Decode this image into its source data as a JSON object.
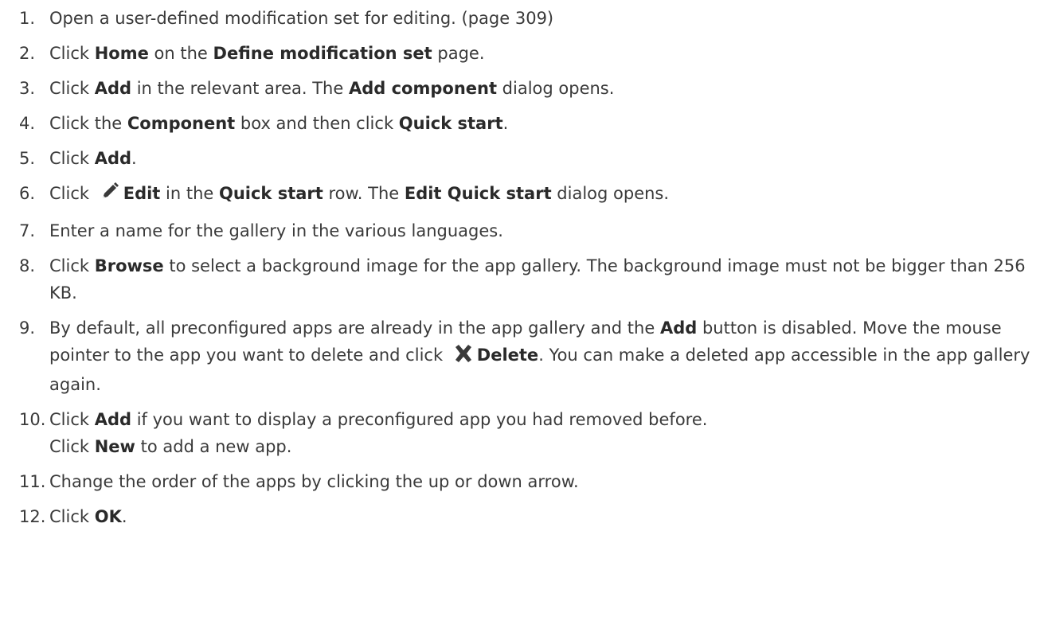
{
  "steps": [
    {
      "num": "1.",
      "parts": [
        {
          "t": "Open a user-defined modification set for editing. (page 309)"
        }
      ]
    },
    {
      "num": "2.",
      "parts": [
        {
          "t": "Click "
        },
        {
          "b": "Home"
        },
        {
          "t": " on the "
        },
        {
          "b": "Define modification set"
        },
        {
          "t": " page."
        }
      ]
    },
    {
      "num": "3.",
      "parts": [
        {
          "t": "Click "
        },
        {
          "b": "Add"
        },
        {
          "t": " in the relevant area. The "
        },
        {
          "b": "Add component"
        },
        {
          "t": " dialog opens."
        }
      ]
    },
    {
      "num": "4.",
      "parts": [
        {
          "t": "Click the "
        },
        {
          "b": "Component"
        },
        {
          "t": " box and then click "
        },
        {
          "b": "Quick start"
        },
        {
          "t": "."
        }
      ]
    },
    {
      "num": "5.",
      "parts": [
        {
          "t": "Click "
        },
        {
          "b": "Add"
        },
        {
          "t": "."
        }
      ]
    },
    {
      "num": "6.",
      "parts": [
        {
          "t": "Click "
        },
        {
          "icon": "pencil-icon"
        },
        {
          "b": "Edit"
        },
        {
          "t": " in the "
        },
        {
          "b": "Quick start"
        },
        {
          "t": " row. The "
        },
        {
          "b": "Edit Quick start"
        },
        {
          "t": " dialog opens."
        }
      ]
    },
    {
      "num": "7.",
      "parts": [
        {
          "t": "Enter a name for the gallery in the various languages."
        }
      ]
    },
    {
      "num": "8.",
      "parts": [
        {
          "t": "Click "
        },
        {
          "b": "Browse"
        },
        {
          "t": " to select a background image for the app gallery. The background image must not be bigger than 256 KB."
        }
      ]
    },
    {
      "num": "9.",
      "parts": [
        {
          "t": "By default, all preconfigured apps are already in the app gallery and the "
        },
        {
          "b": "Add"
        },
        {
          "t": " button is disabled. Move the mouse pointer to the app you want to delete and click "
        },
        {
          "icon": "delete-x-icon"
        },
        {
          "b": "Delete"
        },
        {
          "t": ". You can make a deleted app accessible in the app gallery again."
        }
      ]
    },
    {
      "num": "10.",
      "parts": [
        {
          "t": "Click "
        },
        {
          "b": "Add"
        },
        {
          "t": " if you want to display a preconfigured app you had removed before."
        }
      ],
      "sub": [
        {
          "t": "Click "
        },
        {
          "b": "New"
        },
        {
          "t": " to add a new app."
        }
      ]
    },
    {
      "num": "11.",
      "parts": [
        {
          "t": "Change the order of the apps by clicking the up or down arrow."
        }
      ]
    },
    {
      "num": "12.",
      "parts": [
        {
          "t": "Click "
        },
        {
          "b": "OK"
        },
        {
          "t": "."
        }
      ]
    }
  ]
}
